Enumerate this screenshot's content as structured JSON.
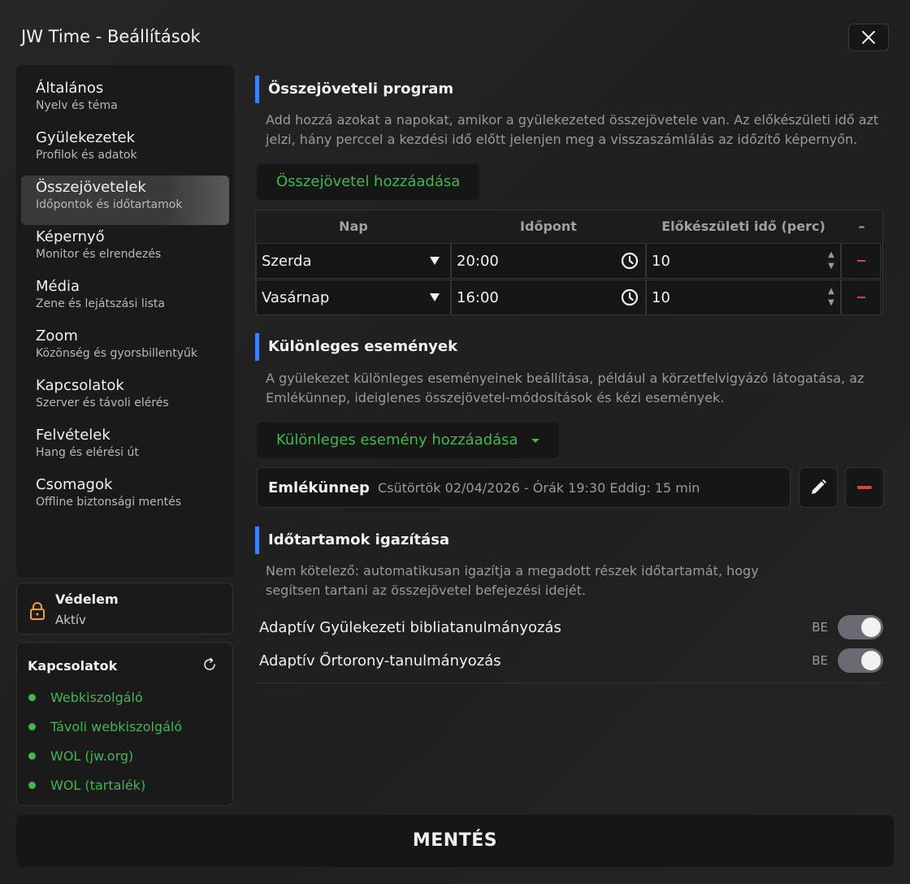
{
  "window": {
    "title": "JW Time - Beállítások",
    "close_icon": "close-icon"
  },
  "sidebar": {
    "items": [
      {
        "title": "Általános",
        "sub": "Nyelv és téma"
      },
      {
        "title": "Gyülekezetek",
        "sub": "Profilok és adatok"
      },
      {
        "title": "Összejövetelek",
        "sub": "Időpontok és időtartamok"
      },
      {
        "title": "Képernyő",
        "sub": "Monitor és elrendezés"
      },
      {
        "title": "Média",
        "sub": "Zene és lejátszási lista"
      },
      {
        "title": "Zoom",
        "sub": "Közönség és gyorsbillentyűk"
      },
      {
        "title": "Kapcsolatok",
        "sub": "Szerver és távoli elérés"
      },
      {
        "title": "Felvételek",
        "sub": "Hang és elérési út"
      },
      {
        "title": "Csomagok",
        "sub": "Offline biztonsági mentés"
      }
    ],
    "active_index": 2
  },
  "protection": {
    "title": "Védelem",
    "status": "Aktív",
    "lock_color": "#f0a030"
  },
  "connections": {
    "title": "Kapcsolatok",
    "items": [
      "Webkiszolgáló",
      "Távoli webkiszolgáló",
      "WOL (jw.org)",
      "WOL (tartalék)"
    ],
    "status_color": "#3fb850"
  },
  "program": {
    "title": "Összejöveteli program",
    "desc": "Add hozzá azokat a napokat, amikor a gyülekezeted összejövetele van. Az előkészületi idő azt jelzi, hány perccel a kezdési idő előtt jelenjen meg a visszaszámlálás az időzítő képernyőn.",
    "add_label": "Összejövetel hozzáadása",
    "columns": [
      "Nap",
      "Időpont",
      "Előkészületi idő (perc)",
      "–"
    ],
    "rows": [
      {
        "day": "Szerda",
        "time": "20:00",
        "prep": "10"
      },
      {
        "day": "Vasárnap",
        "time": "16:00",
        "prep": "10"
      }
    ]
  },
  "special": {
    "title": "Különleges események",
    "desc": "A gyülekezet különleges eseményeinek beállítása, például a körzetfelvigyázó látogatása, az Emlékünnep, ideiglenes összejövetel-módosítások és kézi események.",
    "add_label": "Különleges esemény hozzáadása",
    "event": {
      "name": "Emlékünnep",
      "meta": "Csütörtök 02/04/2026 - Órák 19:30 Eddig: 15 min"
    }
  },
  "adjust": {
    "title": "Időtartamok igazítása",
    "desc": "Nem kötelező: automatikusan igazítja a megadott részek időtartamát, hogy segítsen tartani az összejövetel befejezési idejét.",
    "toggles": [
      {
        "label": "Adaptív Gyülekezeti bibliatanulmányozás",
        "state": "BE",
        "on": true
      },
      {
        "label": "Adaptív Őrtorony-tanulmányozás",
        "state": "BE",
        "on": true
      }
    ]
  },
  "footer": {
    "save_label": "MENTÉS"
  },
  "colors": {
    "accent_blue": "#3b82f6",
    "green": "#3fb850",
    "red": "#e04040"
  }
}
